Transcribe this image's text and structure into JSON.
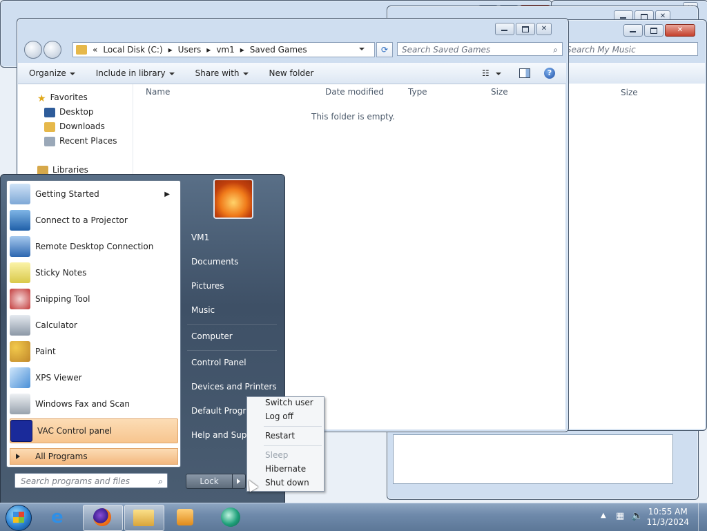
{
  "explorer": {
    "address": {
      "prefix": "«",
      "parts": [
        "Local Disk (C:)",
        "Users",
        "vm1",
        "Saved Games"
      ]
    },
    "search_placeholder": "Search Saved Games",
    "toolbar": {
      "organize": "Organize",
      "include": "Include in library",
      "share": "Share with",
      "newfolder": "New folder"
    },
    "nav": {
      "favorites": "Favorites",
      "desktop": "Desktop",
      "downloads": "Downloads",
      "recent": "Recent Places",
      "libraries": "Libraries"
    },
    "columns": {
      "name": "Name",
      "date": "Date modified",
      "type": "Type",
      "size": "Size"
    },
    "empty": "This folder is empty."
  },
  "bg_window": {
    "search_placeholder": "Search My Music",
    "size_col": "Size"
  },
  "startmenu": {
    "programs": [
      {
        "label": "Getting Started"
      },
      {
        "label": "Connect to a Projector"
      },
      {
        "label": "Remote Desktop Connection"
      },
      {
        "label": "Sticky Notes"
      },
      {
        "label": "Snipping Tool"
      },
      {
        "label": "Calculator"
      },
      {
        "label": "Paint"
      },
      {
        "label": "XPS Viewer"
      },
      {
        "label": "Windows Fax and Scan"
      },
      {
        "label": "VAC Control panel"
      }
    ],
    "all_programs": "All Programs",
    "search_placeholder": "Search programs and files",
    "right": {
      "user": "VM1",
      "documents": "Documents",
      "pictures": "Pictures",
      "music": "Music",
      "computer": "Computer",
      "control_panel": "Control Panel",
      "devices": "Devices and Printers",
      "default_programs": "Default Programs",
      "help": "Help and Support"
    },
    "lock": "Lock"
  },
  "ctxmenu": {
    "switch": "Switch user",
    "logoff": "Log off",
    "restart": "Restart",
    "sleep": "Sleep",
    "hibernate": "Hibernate",
    "shutdown": "Shut down"
  },
  "taskbar": {
    "time": "10:55 AM",
    "date": "11/3/2024"
  }
}
